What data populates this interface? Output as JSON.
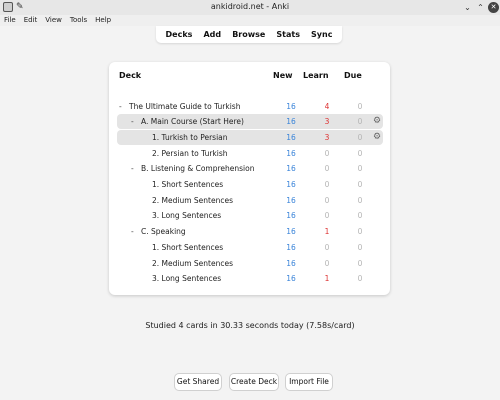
{
  "window": {
    "title": "ankidroid.net - Anki"
  },
  "menu": [
    "File",
    "Edit",
    "View",
    "Tools",
    "Help"
  ],
  "toolbar": [
    "Decks",
    "Add",
    "Browse",
    "Stats",
    "Sync"
  ],
  "deck_table": {
    "headers": {
      "deck": "Deck",
      "new": "New",
      "learn": "Learn",
      "due": "Due"
    },
    "rows": [
      {
        "toggle": "-",
        "name": "The Ultimate Guide to Turkish",
        "new": "16",
        "learn": "4",
        "due": "0"
      },
      {
        "toggle": "-",
        "name": "A. Main Course (Start Here)",
        "new": "16",
        "learn": "3",
        "due": "0"
      },
      {
        "toggle": "",
        "name": "1. Turkish to Persian",
        "new": "16",
        "learn": "3",
        "due": "0"
      },
      {
        "toggle": "",
        "name": "2. Persian to Turkish",
        "new": "16",
        "learn": "0",
        "due": "0"
      },
      {
        "toggle": "-",
        "name": "B. Listening & Comprehension",
        "new": "16",
        "learn": "0",
        "due": "0"
      },
      {
        "toggle": "",
        "name": "1. Short Sentences",
        "new": "16",
        "learn": "0",
        "due": "0"
      },
      {
        "toggle": "",
        "name": "2. Medium Sentences",
        "new": "16",
        "learn": "0",
        "due": "0"
      },
      {
        "toggle": "",
        "name": "3. Long Sentences",
        "new": "16",
        "learn": "0",
        "due": "0"
      },
      {
        "toggle": "-",
        "name": "C. Speaking",
        "new": "16",
        "learn": "1",
        "due": "0"
      },
      {
        "toggle": "",
        "name": "1. Short Sentences",
        "new": "16",
        "learn": "0",
        "due": "0"
      },
      {
        "toggle": "",
        "name": "2. Medium Sentences",
        "new": "16",
        "learn": "0",
        "due": "0"
      },
      {
        "toggle": "",
        "name": "3. Long Sentences",
        "new": "16",
        "learn": "1",
        "due": "0"
      }
    ]
  },
  "studied": "Studied 4 cards in 30.33 seconds today (7.58s/card)",
  "buttons": {
    "get_shared": "Get Shared",
    "create_deck": "Create Deck",
    "import_file": "Import File"
  },
  "colors": {
    "new": "#3a84d9",
    "learn": "#dd3333",
    "due": "#b5b5b5",
    "selected_row": "#e4e4e4"
  },
  "icons": {
    "row_options": "gear-icon"
  }
}
